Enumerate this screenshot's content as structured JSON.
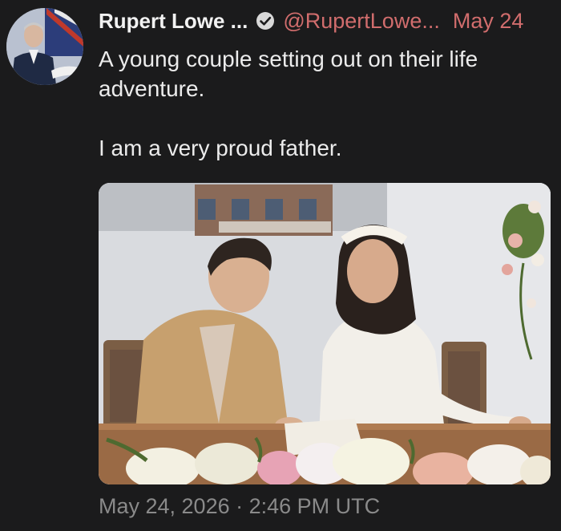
{
  "author": {
    "name": "Rupert Lowe ...",
    "handle": "@RupertLowe...",
    "verified_icon": "check-circle-icon",
    "avatar_icon": "profile-avatar"
  },
  "post": {
    "date_short": "May 24",
    "text_line1": "A young couple setting out on their life adventure.",
    "text_line2": "I am a very proud father.",
    "media_icon": "wedding-photo",
    "timestamp": "May 24, 2026 · 2:46 PM UTC"
  },
  "colors": {
    "background": "#1b1b1c",
    "handle": "#d16d6d",
    "timestamp": "#8a8a8a"
  }
}
